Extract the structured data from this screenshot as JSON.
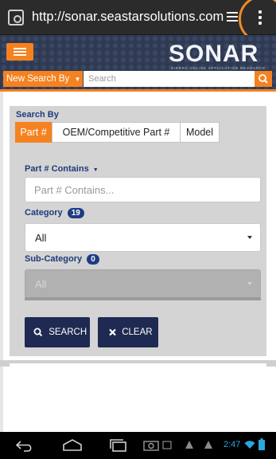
{
  "browser": {
    "url": "http://sonar.seastarsolutions.com",
    "icons": {
      "site": "site-settings-icon",
      "tabs": "tabs-icon",
      "menu": "kebab-menu-icon"
    }
  },
  "header": {
    "brand_logo": "SONAR",
    "brand_tagline": "SIERRA ONLINE APPLICATION RESOURCE",
    "menu_icon": "hamburger-icon",
    "new_search_label": "New Search By",
    "search_placeholder": "Search",
    "search_icon": "search-icon"
  },
  "form": {
    "search_by_label": "Search By",
    "search_by_options": [
      {
        "label": "Part #",
        "active": true
      },
      {
        "label": "OEM/Competitive Part #",
        "active": false
      },
      {
        "label": "Model",
        "active": false
      }
    ],
    "part_contains_label": "Part # Contains",
    "part_contains_placeholder": "Part # Contains...",
    "category_label": "Category",
    "category_count": "19",
    "category_value": "All",
    "subcategory_label": "Sub-Category",
    "subcategory_count": "0",
    "subcategory_value": "All",
    "search_button": "SEARCH",
    "clear_button": "CLEAR"
  },
  "system": {
    "time": "2:47",
    "nav_icons": [
      "back-icon",
      "home-icon",
      "recent-apps-icon"
    ],
    "status_icons": [
      "screenshot-icon",
      "gallery-icon",
      "warning-icon",
      "warning-icon",
      "wifi-icon",
      "battery-icon"
    ]
  },
  "colors": {
    "accent": "#f58220",
    "navy": "#1e2a52",
    "label_blue": "#1f3a7a",
    "header_bg": "#2f3a52"
  }
}
